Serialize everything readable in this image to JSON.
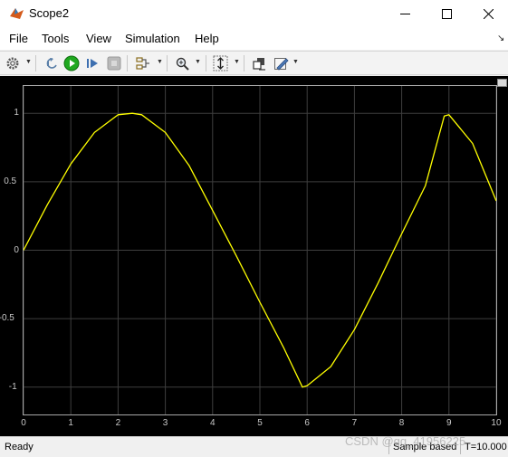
{
  "window": {
    "title": "Scope2",
    "minimize_icon": "minimize-icon",
    "maximize_icon": "maximize-icon",
    "close_icon": "close-icon"
  },
  "menu": {
    "items": [
      "File",
      "Tools",
      "View",
      "Simulation",
      "Help"
    ],
    "undock_glyph": "↘"
  },
  "toolbar": {
    "icons": [
      "gear-icon",
      "step-back-icon",
      "run-icon",
      "step-forward-icon",
      "stop-icon",
      "signal-select-icon",
      "zoom-icon",
      "autoscale-icon",
      "highlight-icon",
      "style-icon"
    ]
  },
  "colors": {
    "trace": "#ffff00",
    "grid": "#3e3e3e",
    "background": "#000000",
    "run_button": "#1fa81f"
  },
  "chart_data": {
    "type": "line",
    "title": "",
    "xlabel": "",
    "ylabel": "",
    "xlim": [
      0,
      10
    ],
    "ylim": [
      -1.2,
      1.2
    ],
    "xticks": [
      "0",
      "1",
      "2",
      "3",
      "4",
      "5",
      "6",
      "7",
      "8",
      "9",
      "10"
    ],
    "yticks": [
      "1",
      "0.5",
      "0",
      "-0.5",
      "-1"
    ],
    "grid": true,
    "series": [
      {
        "x": [
          0,
          0.5,
          1,
          1.5,
          2,
          2.3,
          2.5,
          3,
          3.5,
          4,
          4.5,
          5,
          5.5,
          5.9,
          6,
          6.5,
          7,
          7.5,
          8,
          8.5,
          8.9,
          9,
          9.5,
          10
        ],
        "y": [
          0,
          0.33,
          0.63,
          0.86,
          0.99,
          1.0,
          0.99,
          0.86,
          0.62,
          0.29,
          -0.04,
          -0.38,
          -0.71,
          -1.0,
          -0.99,
          -0.85,
          -0.58,
          -0.24,
          0.12,
          0.47,
          0.98,
          0.99,
          0.78,
          0.36
        ]
      }
    ]
  },
  "status": {
    "ready": "Ready",
    "mode": "Sample based",
    "time": "T=10.000"
  },
  "watermark": "CSDN @qq_41956225"
}
